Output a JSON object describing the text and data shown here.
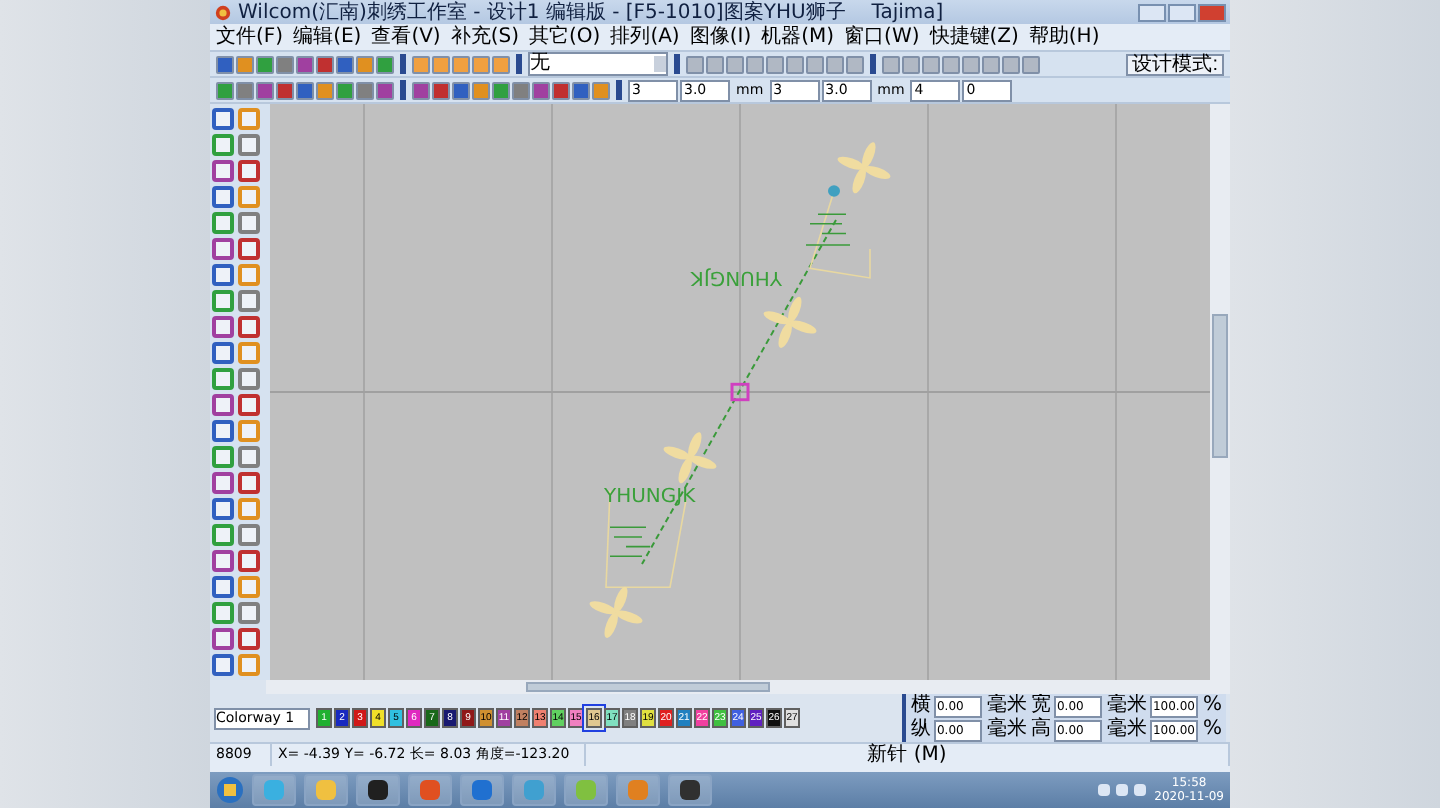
{
  "window": {
    "title": "Wilcom(汇南)刺绣工作室 - 设计1 编辑版 - [F5-1010]图案YHU狮子",
    "title_suffix": "Tajima]"
  },
  "menu": [
    "文件(F)",
    "编辑(E)",
    "查看(V)",
    "补充(S)",
    "其它(O)",
    "排列(A)",
    "图像(I)",
    "机器(M)",
    "窗口(W)",
    "快捷键(Z)",
    "帮助(H)"
  ],
  "toolbar": {
    "fill_dropdown": "无",
    "mode_button": "设计模式:",
    "fields": [
      {
        "value": "3"
      },
      {
        "value": "3.0",
        "unit": "mm"
      },
      {
        "value": "3"
      },
      {
        "value": "3.0",
        "unit": "mm"
      },
      {
        "value": "4"
      },
      {
        "value": "0"
      }
    ]
  },
  "canvas": {
    "design_texts": [
      "YHUNGJK",
      "YHUNGJK"
    ]
  },
  "palette": {
    "colorway": "Colorway 1",
    "colors": [
      {
        "label": "1",
        "color": "#20b030",
        "selected": false
      },
      {
        "label": "2",
        "color": "#1828c0",
        "selected": false
      },
      {
        "label": "3",
        "color": "#d01818",
        "selected": false
      },
      {
        "label": "4",
        "color": "#f0e028",
        "selected": false
      },
      {
        "label": "5",
        "color": "#30c0e0",
        "selected": false
      },
      {
        "label": "6",
        "color": "#e028c0",
        "selected": false
      },
      {
        "label": "7",
        "color": "#186818",
        "selected": false
      },
      {
        "label": "8",
        "color": "#181870",
        "selected": false
      },
      {
        "label": "9",
        "color": "#901818",
        "selected": false
      },
      {
        "label": "10",
        "color": "#d09030",
        "selected": false
      },
      {
        "label": "11",
        "color": "#a040a0",
        "selected": false
      },
      {
        "label": "12",
        "color": "#c08060",
        "selected": false
      },
      {
        "label": "13",
        "color": "#f08070",
        "selected": false
      },
      {
        "label": "14",
        "color": "#60d060",
        "selected": false
      },
      {
        "label": "15",
        "color": "#f080c0",
        "selected": false
      },
      {
        "label": "16",
        "color": "#e0c890",
        "selected": true
      },
      {
        "label": "17",
        "color": "#80e0c0",
        "selected": false
      },
      {
        "label": "18",
        "color": "#808080",
        "selected": false
      },
      {
        "label": "19",
        "color": "#e0e040",
        "selected": false
      },
      {
        "label": "20",
        "color": "#e02020",
        "selected": false
      },
      {
        "label": "21",
        "color": "#2080c0",
        "selected": false
      },
      {
        "label": "22",
        "color": "#f040a0",
        "selected": false
      },
      {
        "label": "23",
        "color": "#40c040",
        "selected": false
      },
      {
        "label": "24",
        "color": "#4060e0",
        "selected": false
      },
      {
        "label": "25",
        "color": "#6020c0",
        "selected": false
      },
      {
        "label": "26",
        "color": "#101010",
        "selected": false
      },
      {
        "label": "27",
        "color": "#e0e0e0",
        "selected": false
      }
    ]
  },
  "transform": [
    {
      "label": "横",
      "value": "0.00",
      "unit": "毫米",
      "label2": "宽",
      "value2": "0.00",
      "unit2": "毫米",
      "percent": "100.00",
      "sign": "%"
    },
    {
      "label": "纵",
      "value": "0.00",
      "unit": "毫米",
      "label2": "高",
      "value2": "0.00",
      "unit2": "毫米",
      "percent": "100.00",
      "sign": "%"
    }
  ],
  "status": {
    "stitch_count": "8809",
    "coords": "X= -4.39 Y= -6.72 长= 8.03 角度=-123.20",
    "mode": "新针 (M)"
  },
  "taskbar": {
    "time": "15:58",
    "date": "2020-11-09"
  }
}
